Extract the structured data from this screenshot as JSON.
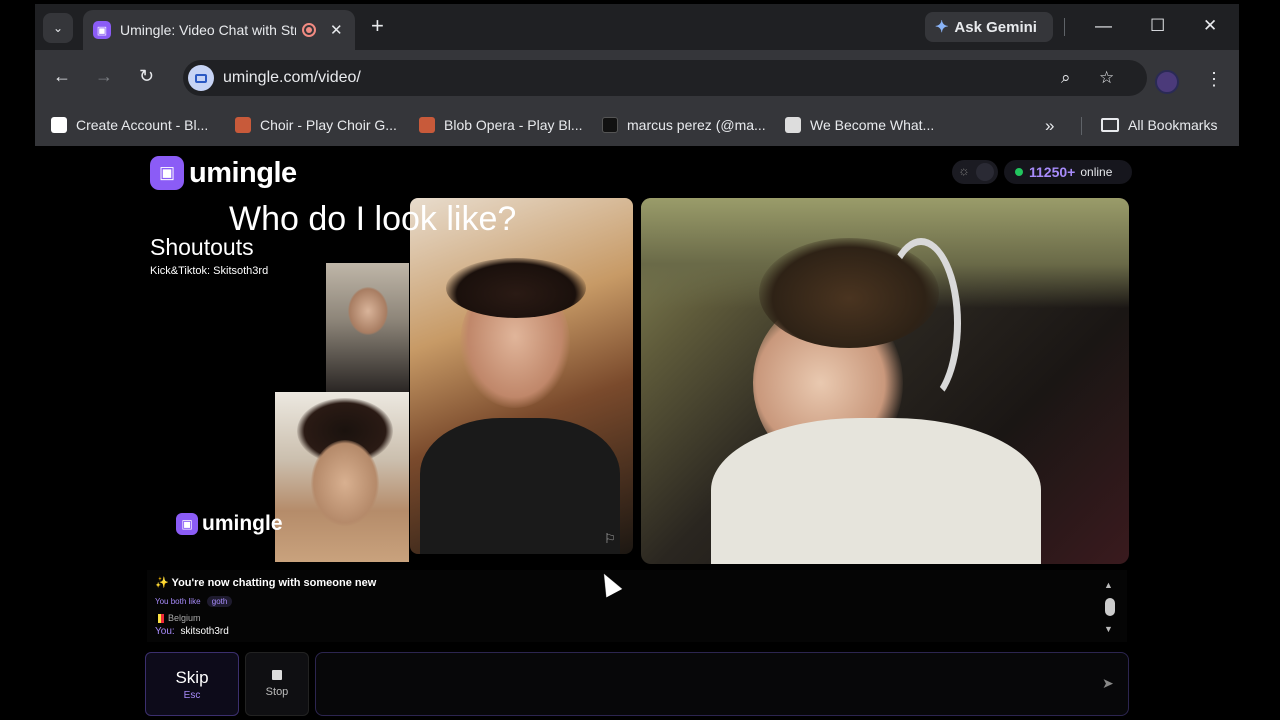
{
  "tab": {
    "title": "Umingle: Video Chat with Strangers",
    "favicon": "umingle-chat-icon"
  },
  "toolbar": {
    "url": "umingle.com/video/",
    "gemini_label": "Ask Gemini"
  },
  "bookmarks": [
    {
      "label": "Create Account - Bl...",
      "icon": "bl-icon",
      "color": "#ffffff"
    },
    {
      "label": "Choir - Play Choir G...",
      "icon": "choir-icon",
      "color": "#c85a3a"
    },
    {
      "label": "Blob Opera - Play Bl...",
      "icon": "blob-icon",
      "color": "#c85a3a"
    },
    {
      "label": "marcus perez (@ma...",
      "icon": "tiktok-icon",
      "color": "#000000"
    },
    {
      "label": "We Become What...",
      "icon": "game-icon",
      "color": "#dddddd"
    }
  ],
  "all_bookmarks_label": "All Bookmarks",
  "site": {
    "logo_text": "umingle",
    "online_count": "11250+",
    "online_label": "online"
  },
  "stream_overlay": {
    "title": "Who do I look like?",
    "shoutouts": "Shoutouts",
    "shoutouts_sub": "Kick&Tiktok: Skitsoth3rd",
    "watermark": "umingle"
  },
  "chat": {
    "system_msg": "✨ You're now chatting with someone new",
    "both_like_label": "You both like",
    "interest_tag": "goth",
    "country": "Belgium",
    "you_label": "You:",
    "you_msg": "skitsoth3rd"
  },
  "controls": {
    "skip_label": "Skip",
    "skip_hint": "Esc",
    "stop_label": "Stop",
    "message_placeholder": ""
  },
  "colors": {
    "accent": "#8b5cf6",
    "online_dot": "#22c55e"
  }
}
